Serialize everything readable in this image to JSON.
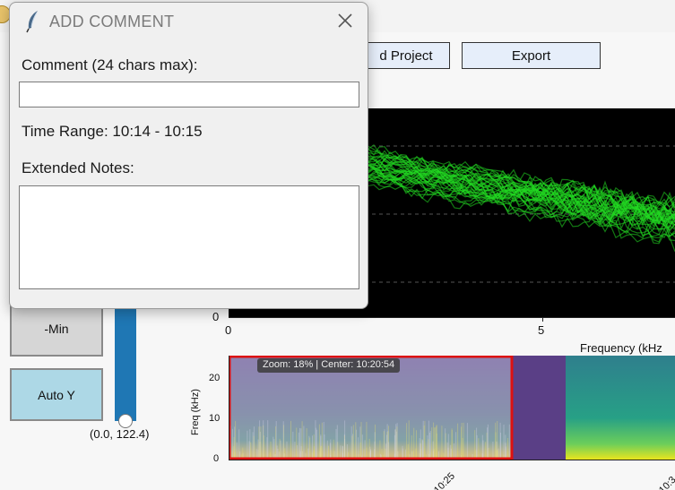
{
  "toolbar": {
    "load_project_label": "d Project",
    "export_label": "Export"
  },
  "controls": {
    "min_label": "-Min",
    "auto_y_label": "Auto Y",
    "slider_value": "(0.0, 122.4)"
  },
  "main_plot": {
    "y_tick_0": "0",
    "x_tick_0": "0",
    "x_tick_5": "5",
    "x_axis_title": "Frequency (kHz"
  },
  "overview": {
    "zoom_tooltip": "Zoom: 18% | Center: 10:20:54",
    "y_axis_title": "Freq (kHz)",
    "y_ticks": [
      "20",
      "10",
      "0"
    ],
    "x_ticks": [
      "10:25",
      "10:3"
    ]
  },
  "dialog": {
    "title": "ADD COMMENT",
    "comment_label": "Comment (24 chars max):",
    "comment_value": "",
    "time_range_label": "Time Range: 10:14 - 10:15",
    "notes_label": "Extended Notes:",
    "notes_value": ""
  },
  "colors": {
    "accent_blue": "#1f77b4",
    "button_light_blue": "#add8e6",
    "trace_green": "#22dd22",
    "selection_red": "#dd1111"
  },
  "icons": [
    "app-logo-icon",
    "feather-icon",
    "close-icon"
  ]
}
